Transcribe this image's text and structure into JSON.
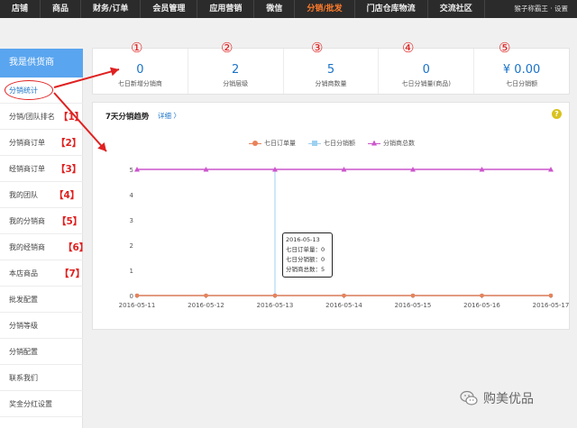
{
  "nav": {
    "items": [
      "店铺",
      "商品",
      "财务/订单",
      "会员管理",
      "应用营销",
      "微信",
      "分销/批发",
      "门店仓库物流",
      "交流社区"
    ],
    "active_index": 6,
    "user": "猴子称霸王 · 设置"
  },
  "sidebar": {
    "title": "我是供货商",
    "items": [
      {
        "label": "分销统计",
        "marker": ""
      },
      {
        "label": "分销/团队排名",
        "marker": "【1】"
      },
      {
        "label": "分销商订单",
        "marker": "【2】"
      },
      {
        "label": "经销商订单",
        "marker": "【3】"
      },
      {
        "label": "我的团队",
        "marker": "【4】"
      },
      {
        "label": "我的分销商",
        "marker": "【5】"
      },
      {
        "label": "我的经销商",
        "marker": "【6】"
      },
      {
        "label": "本店商品",
        "marker": "【7】"
      },
      {
        "label": "批发配置",
        "marker": ""
      },
      {
        "label": "分销等级",
        "marker": ""
      },
      {
        "label": "分销配置",
        "marker": ""
      },
      {
        "label": "联系我们",
        "marker": ""
      },
      {
        "label": "奖金分红设置",
        "marker": ""
      }
    ]
  },
  "stats": [
    {
      "num": "①",
      "value": "0",
      "label": "七日新增分销商"
    },
    {
      "num": "②",
      "value": "2",
      "label": "分销层级"
    },
    {
      "num": "③",
      "value": "5",
      "label": "分销商数量"
    },
    {
      "num": "④",
      "value": "0",
      "label": "七日分销量(商品)"
    },
    {
      "num": "⑤",
      "value": "¥ 0.00",
      "label": "七日分销额"
    }
  ],
  "trend": {
    "title": "7天分销趋势",
    "link": "详细 〉",
    "help": "?"
  },
  "tooltip": {
    "date": "2016-05-13",
    "lines": [
      "七日订单量：0",
      "七日分销额：0",
      "分销商总数：5"
    ]
  },
  "colors": {
    "orders": "#e8825a",
    "amount": "#9dd0f0",
    "total": "#cc55cc",
    "accent": "#1a73c8",
    "marker": "#e02020"
  },
  "chart_data": {
    "type": "line",
    "x": [
      "2016-05-11",
      "2016-05-12",
      "2016-05-13",
      "2016-05-14",
      "2016-05-15",
      "2016-05-16",
      "2016-05-17"
    ],
    "series": [
      {
        "name": "七日订单量",
        "values": [
          0,
          0,
          0,
          0,
          0,
          0,
          0
        ]
      },
      {
        "name": "七日分销额",
        "values": [
          0,
          0,
          0,
          0,
          0,
          0,
          0
        ]
      },
      {
        "name": "分销商总数",
        "values": [
          5,
          5,
          5,
          5,
          5,
          5,
          5
        ]
      }
    ],
    "yticks": [
      0,
      1,
      2,
      3,
      4,
      5
    ],
    "ylim": [
      0,
      5
    ],
    "legend": "top-center",
    "grid": false
  },
  "watermark": "购美优品"
}
